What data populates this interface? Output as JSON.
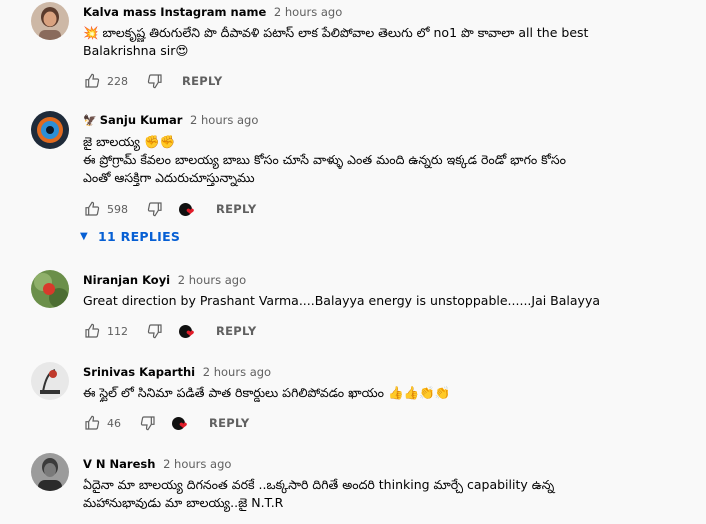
{
  "comments": [
    {
      "author": "Kalva mass Instagram name",
      "time": "2 hours ago",
      "lines": [
        "💥 బాలకృష్ణ తిరుగులేని పొ దీపావళి పటాస్ లాక పేలిపోవాల తెలుగు లో no1 పొ కావాలా all the best",
        "Balakrishna sir😍"
      ],
      "likes": "228",
      "reply_label": "REPLY",
      "has_creator_heart": false
    },
    {
      "author": "Sanju Kumar",
      "badge": "🦅",
      "time": "2 hours ago",
      "lines": [
        "జై బాలయ్య ✊✊",
        "ఈ ప్రోగ్రామ్ కేవలం బాలయ్య బాబు కోసం చూసే వాళ్ళు ఎంత మంది ఉన్నరు ఇక్కడ రెండో భాగం కోసం",
        "ఎంతో ఆసక్తిగా ఎదురుచూస్తున్నాము"
      ],
      "likes": "598",
      "reply_label": "REPLY",
      "has_creator_heart": true,
      "replies_label": "11 REPLIES"
    },
    {
      "author": "Niranjan Koyi",
      "time": "2 hours ago",
      "lines": [
        "Great direction by Prashant Varma....Balayya energy is unstoppable......Jai Balayya"
      ],
      "likes": "112",
      "reply_label": "REPLY",
      "has_creator_heart": true
    },
    {
      "author": "Srinivas Kaparthi",
      "time": "2 hours ago",
      "lines": [
        "ఈ స్టైల్ లో సినిమా పడితే పాత రికార్డులు పగిలిపోవడం ఖాయం 👍👍👏👏"
      ],
      "likes": "46",
      "reply_label": "REPLY",
      "has_creator_heart": true
    },
    {
      "author": "V N Naresh",
      "time": "2 hours ago",
      "lines": [
        "ఏదైనా మా బాలయ్య దిగనంత వరకే ..ఒక్కసారి దిగితే అందరి thinking మార్చే capability ఉన్న",
        "మహానుభావుడు మా బాలయ్య..జై N.T.R"
      ]
    }
  ],
  "colors": {
    "background": "#f9f9f9",
    "text": "#030303",
    "secondary": "#606060",
    "link_blue": "#065fd4",
    "heart_red": "#e11d2a"
  },
  "icons": {
    "like": "thumb-up-icon",
    "dislike": "thumb-down-icon",
    "creator_heart": "creator-heart-icon",
    "expand": "caret-down-icon"
  }
}
